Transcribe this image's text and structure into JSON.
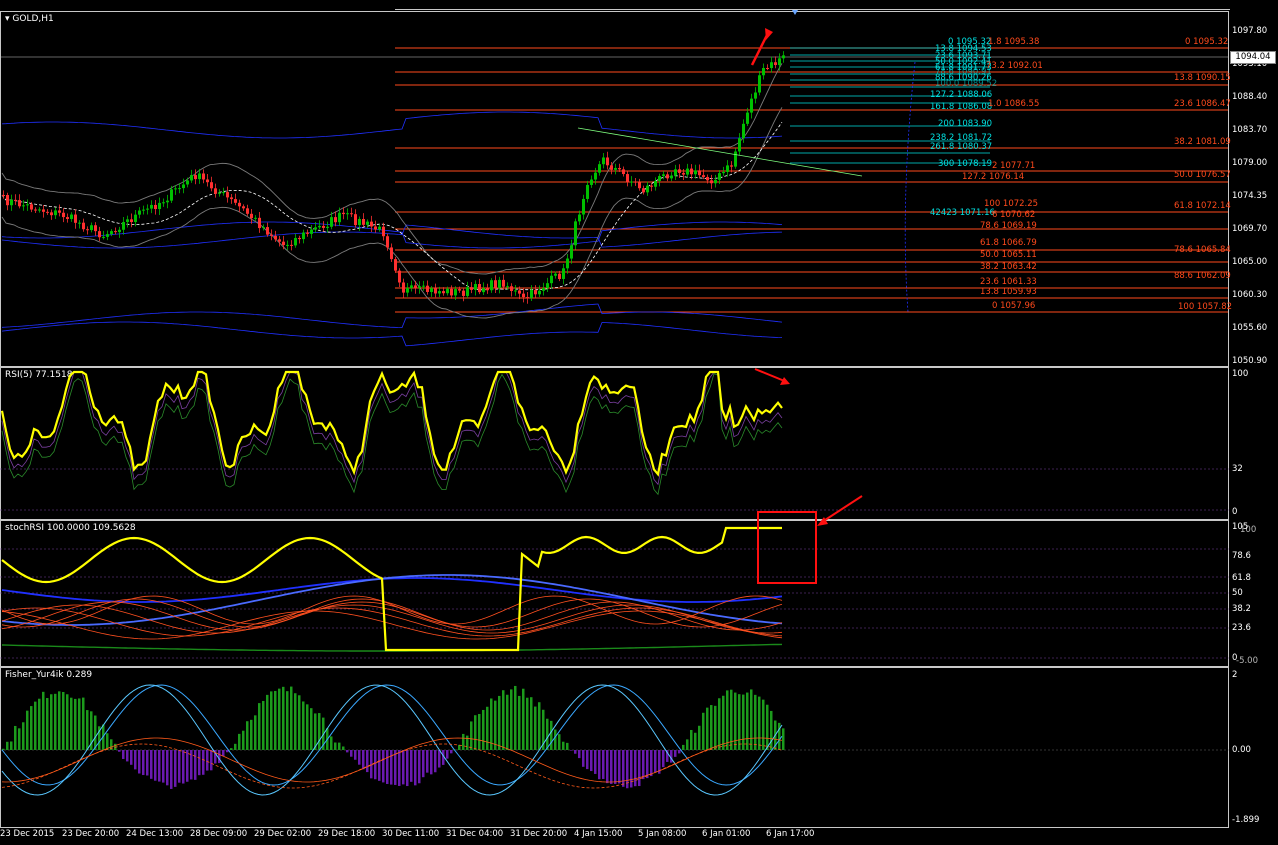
{
  "symbol_label": "GOLD,H1",
  "rsi_label": "RSI(5) 77.1518",
  "stoch_label": "stochRSI 100.0000 109.5628",
  "fisher_label": "Fisher_Yur4ik 0.289",
  "current_price": "1094.04",
  "price_axis": [
    "1097.80",
    "1093.10",
    "1088.40",
    "1083.70",
    "1079.00",
    "1074.35",
    "1069.70",
    "1065.00",
    "1060.30",
    "1055.60",
    "1050.90"
  ],
  "rsi_axis": [
    "100",
    "32",
    "0"
  ],
  "stoch_axis": [
    "105",
    "100",
    "78.6",
    "61.8",
    "50",
    "38.2",
    "23.6",
    "0",
    "-5.00"
  ],
  "fisher_axis": [
    "2",
    "0.00",
    "-1.899"
  ],
  "time_axis": [
    "23 Dec 2015",
    "23 Dec 20:00",
    "24 Dec 13:00",
    "28 Dec 09:00",
    "29 Dec 02:00",
    "29 Dec 18:00",
    "30 Dec 11:00",
    "31 Dec 04:00",
    "31 Dec 20:00",
    "4 Jan 15:00",
    "5 Jan 08:00",
    "6 Jan 01:00",
    "6 Jan 17:00"
  ],
  "fib_labels_cyan": [
    "0 1095.32",
    "13.8 1094.53",
    "23.6 1093.71",
    "50.0 1092.41",
    "61.8 1091.73",
    "78.6 1090.91",
    "88.6 1090.26",
    "100.0 1089.52",
    "127.2 1088.06",
    "161.8 1086.08",
    "200 1083.90",
    "238.2 1081.72",
    "261.8 1080.37",
    "300 1078.19",
    "42423 1071.16"
  ],
  "fib_labels_red_mid": [
    "1.8 1095.38",
    "73.2 1092.01",
    "1.0 1086.55",
    "2 1077.71",
    "127.2 1076.14",
    "100 1072.25",
    "6 1070.62",
    "78.6 1069.19",
    "61.8 1066.79",
    "50.0 1065.11",
    "38.2 1063.42",
    "23.6 1061.33",
    "13.8 1059.93",
    "0 1057.96"
  ],
  "fib_labels_red_right": [
    "0 1095.32",
    "13.8 1090.15",
    "23.6 1086.47",
    "38.2 1081.09",
    "50.0 1076.57",
    "61.8 1072.14",
    "78.6 1065.84",
    "88.6 1062.09",
    "100 1057.82"
  ],
  "colors": {
    "bull": "#00c000",
    "bear": "#ff3030",
    "fib": "#ff4a1c",
    "fibcyan": "#00e0e0",
    "yellow": "#ffff00",
    "blue": "#2030ff",
    "arrow": "#ff1010"
  }
}
